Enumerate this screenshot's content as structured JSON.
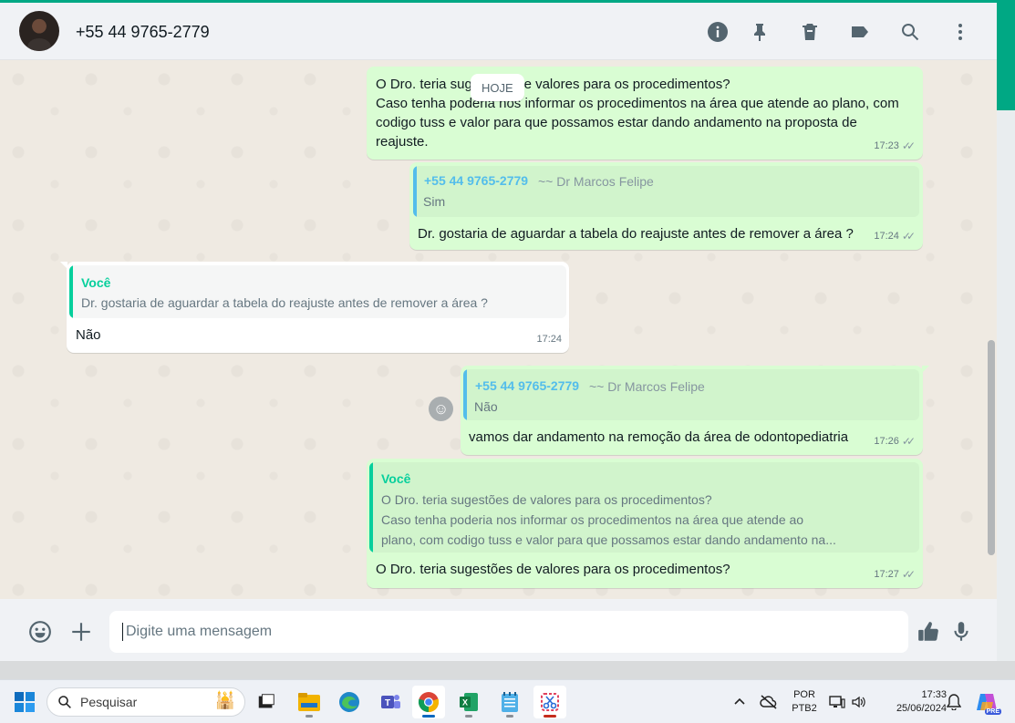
{
  "header": {
    "contact_name": "+55 44 9765-2779",
    "icons": [
      "info-icon",
      "pin-icon",
      "delete-icon",
      "label-icon",
      "search-icon",
      "menu-icon"
    ]
  },
  "date_divider": "HOJE",
  "messages": [
    {
      "id": "m1",
      "direction": "out",
      "text": "O Dro. teria sugestões de valores para os procedimentos?\nCaso tenha poderia nos informar os procedimentos na área que atende ao plano, com\ncodigo tuss e valor para que possamos estar dando andamento na proposta de\nreajuste.",
      "time": "17:23",
      "status": "read"
    },
    {
      "id": "m2",
      "direction": "out",
      "quote": {
        "author": "+55 44 9765-2779",
        "sub": "~~ Dr Marcos Felipe",
        "text": "Sim"
      },
      "text": "Dr. gostaria de aguardar a tabela do reajuste antes de remover a área ?",
      "time": "17:24",
      "status": "read"
    },
    {
      "id": "m3",
      "direction": "in",
      "quote": {
        "author": "Você",
        "text": "Dr. gostaria de aguardar a tabela do reajuste antes de remover a área ?"
      },
      "text": "Não",
      "time": "17:24"
    },
    {
      "id": "m4",
      "direction": "out",
      "quote": {
        "author": "+55 44 9765-2779",
        "sub": "~~ Dr Marcos Felipe",
        "text": "Não"
      },
      "text": "vamos dar andamento na remoção da área de odontopediatria",
      "time": "17:26",
      "status": "read"
    },
    {
      "id": "m5",
      "direction": "out",
      "quote": {
        "author": "Você",
        "text": "O Dro. teria sugestões de valores para os procedimentos?\nCaso tenha poderia nos informar os procedimentos na área que atende ao\nplano, com codigo tuss e valor para que possamos estar dando andamento na..."
      },
      "text": "O Dro. teria sugestões de valores para os procedimentos?",
      "time": "17:27",
      "status": "read"
    }
  ],
  "composer": {
    "placeholder": "Digite uma mensagem",
    "icons": [
      "emoji-icon",
      "attach-plus-icon",
      "like-icon",
      "mic-icon"
    ]
  },
  "colors": {
    "accent": "#00a884",
    "outgoing_bubble": "#d9fdd3",
    "incoming_bubble": "#ffffff",
    "quote_author_contact": "#53bdeb",
    "quote_author_self": "#06cf9c"
  },
  "taskbar": {
    "search_placeholder": "Pesquisar",
    "apps": [
      "windows-start-icon",
      "task-view-icon",
      "file-explorer-icon",
      "edge-icon",
      "teams-icon",
      "chrome-icon",
      "excel-icon",
      "notepad-icon",
      "snipping-tool-icon"
    ],
    "language_line1": "POR",
    "language_line2": "PTB2",
    "time": "17:33",
    "date": "25/06/2024",
    "copilot_badge": "PRE"
  }
}
